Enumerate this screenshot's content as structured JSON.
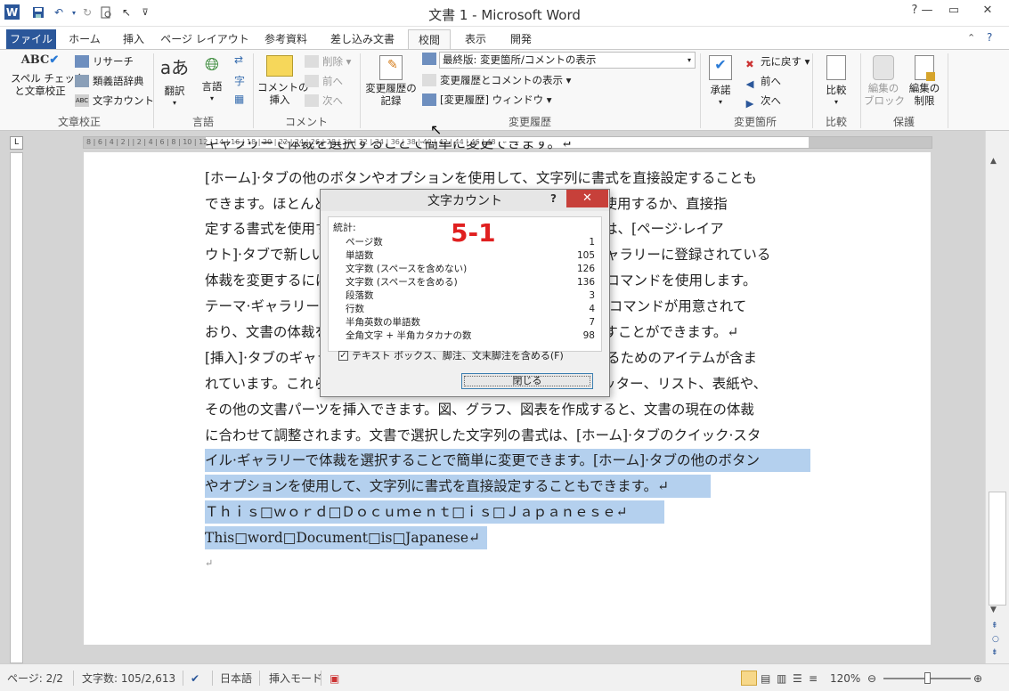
{
  "window": {
    "title": "文書 1 - Microsoft Word"
  },
  "qat": {
    "icons": [
      "word-logo-icon",
      "save-icon",
      "undo-icon",
      "redo-icon",
      "print-preview-icon",
      "pointer-icon",
      "customize-icon"
    ]
  },
  "tabs": [
    "ファイル",
    "ホーム",
    "挿入",
    "ページ レイアウト",
    "参考資料",
    "差し込み文書",
    "校閲",
    "表示",
    "開発"
  ],
  "ribbon": {
    "proofing": {
      "label": "文章校正",
      "spell": "スペル チェック\nと文章校正",
      "research": "リサーチ",
      "thesaurus": "類義語辞典",
      "wordcount": "文字カウント"
    },
    "language": {
      "label": "言語",
      "translate": "翻訳",
      "language": "言語"
    },
    "comments": {
      "label": "コメント",
      "insert": "コメントの\n挿入",
      "delete": "削除",
      "prev": "前へ",
      "next": "次へ"
    },
    "tracking": {
      "label": "変更履歴",
      "track": "変更履歴の\n記録",
      "display_value": "最終版: 変更箇所/コメントの表示",
      "show_markup": "変更履歴とコメントの表示",
      "pane": "[変更履歴] ウィンドウ"
    },
    "changes": {
      "label": "変更箇所",
      "accept": "承諾",
      "reject": "元に戻す",
      "prev": "前へ",
      "next": "次へ"
    },
    "compare": {
      "label": "比較",
      "compare": "比較"
    },
    "protect": {
      "label": "保護",
      "block": "編集の\nブロック",
      "restrict": "編集の\n制限"
    }
  },
  "ruler": {
    "ticks": "8 | 6 | 4 | 2 |   | 2 | 4 | 6 | 8 | 10 | 12 | 14 | 16 | 18 | 20 | 22 | 24 | 26 | 28 | 30 | 32 | 34 | 36 | 38 | 40 | 42 | 44 | 46 | 48"
  },
  "document": {
    "lines": [
      "ギャラリーで体裁を選択することで簡単に変更できます。↵",
      "[ホーム]·タブの他のボタンやオプションを使用して、文字列に書式を直接設定することも",
      "できます。ほとんどのコントロールでは、現在のテーマの体裁を使用するか、直接指",
      "定する書式を使用するかを選択できます。文書全体を変更するには、[ページ·レイア",
      "ウト]·タブで新しいテーマを選択します。[クイック·スタイル]·ギャラリーに登録されている",
      "体裁を変更するには、[ホーム]·タブでスタイルセットを変更するコマンドを使用します。",
      "テーマ·ギャラリーとクイック·スタイル·ギャラリーにはリセット·コマンドが用意されて",
      "おり、文書の体裁を現在のテンプレートの元の体裁にいつでも戻すことができます。↵",
      "[挿入]·タブのギャラリーには、文書全体の体裁に合わせて調整するためのアイテムが含ま",
      "れています。これらのギャラリーを使用して、表、ヘッダー、フッター、リスト、表紙や、",
      "その他の文書パーツを挿入できます。図、グラフ、図表を作成すると、文書の現在の体裁",
      "に合わせて調整されます。文書で選択した文字列の書式は、[ホーム]·タブのクイック·スタ",
      "イル·ギャラリーで体裁を選択することで簡単に変更できます。[ホーム]·タブの他のボタン",
      "やオプションを使用して、文字列に書式を直接設定することもできます。↵",
      "Ｔｈｉｓ□ｗｏｒｄ□Ｄｏｃｕｍｅｎｔ□ｉｓ□Ｊａｐａｎｅｓｅ↵",
      "This□word□Document□is□Japanese↵",
      "↵"
    ]
  },
  "dialog": {
    "title": "文字カウント",
    "help": "?",
    "close_x": "✕",
    "section": "統計:",
    "annotation": "5-1",
    "stats": [
      {
        "label": "ページ数",
        "value": "1"
      },
      {
        "label": "単語数",
        "value": "105"
      },
      {
        "label": "文字数 (スペースを含めない)",
        "value": "126"
      },
      {
        "label": "文字数 (スペースを含める)",
        "value": "136"
      },
      {
        "label": "段落数",
        "value": "3"
      },
      {
        "label": "行数",
        "value": "4"
      },
      {
        "label": "半角英数の単語数",
        "value": "7"
      },
      {
        "label": "全角文字 + 半角カタカナの数",
        "value": "98"
      }
    ],
    "checkbox_label": "テキスト ボックス、脚注、文末脚注を含める(F)",
    "checkbox_checked": true,
    "close_button": "閉じる"
  },
  "status": {
    "page": "ページ: 2/2",
    "words": "文字数: 105/2,613",
    "language": "日本語",
    "mode": "挿入モード",
    "zoom": "120%"
  }
}
